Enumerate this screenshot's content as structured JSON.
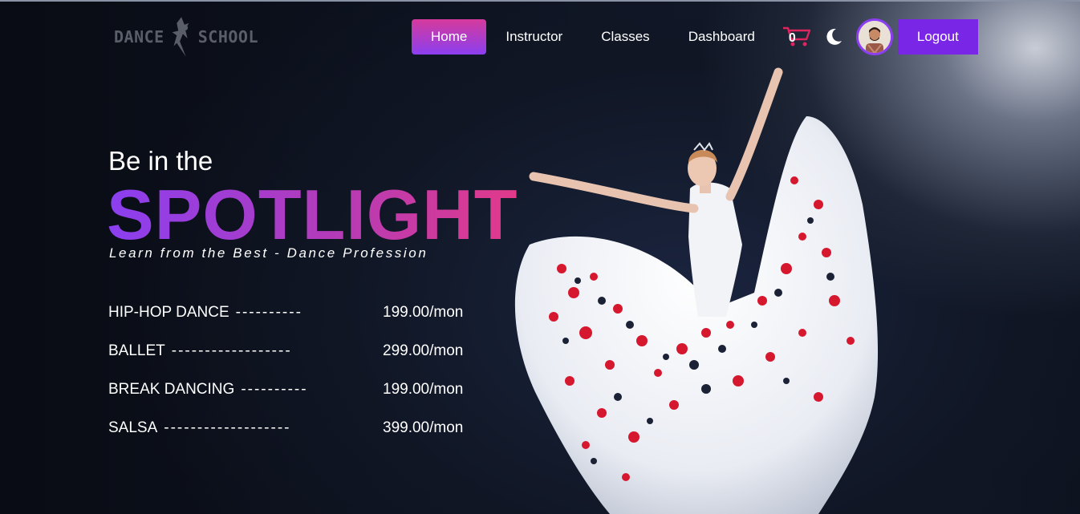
{
  "logo": {
    "left_text": "DANCE",
    "right_text": "SCHOOL"
  },
  "nav": {
    "items": [
      {
        "label": "Home",
        "active": true
      },
      {
        "label": "Instructor"
      },
      {
        "label": "Classes"
      },
      {
        "label": "Dashboard"
      }
    ],
    "cart_count": "0",
    "cart_icon": "cart-icon",
    "theme_icon": "moon-icon",
    "logout_label": "Logout"
  },
  "hero": {
    "kicker": "Be in the",
    "title": "SPOTLIGHT",
    "subtitle": "Learn from the Best - Dance Profession",
    "prices": [
      {
        "name": "HIP-HOP DANCE",
        "dashes": "----------",
        "value": "199.00/mon"
      },
      {
        "name": "BALLET",
        "dashes": "------------------",
        "value": "299.00/mon"
      },
      {
        "name": "BREAK DANCING",
        "dashes": "----------",
        "value": "199.00/mon"
      },
      {
        "name": "SALSA",
        "dashes": "-------------------",
        "value": "399.00/mon"
      }
    ]
  },
  "colors": {
    "accent_purple": "#7a26e6",
    "accent_pink": "#d63a9c",
    "gradient_start": "#8b3ff0",
    "gradient_end": "#e23a8a"
  }
}
